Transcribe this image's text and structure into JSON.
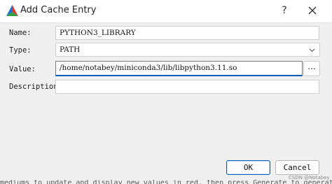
{
  "window": {
    "title": "Add Cache Entry",
    "help_label": "?",
    "accent_color": "#005fb8"
  },
  "form": {
    "name_label": "Name:",
    "name_value": "PYTHON3_LIBRARY",
    "type_label": "Type:",
    "type_value": "PATH",
    "value_label": "Value:",
    "value_value": "/home/notabey/miniconda3/lib/libpython3.11.so",
    "browse_label": "...",
    "description_label": "Description:",
    "description_value": ""
  },
  "buttons": {
    "ok": "OK",
    "cancel": "Cancel"
  },
  "watermark": "CSDN @Notabey",
  "background_text": "mediums to update and display new values in red, then press Generate to generate selected"
}
